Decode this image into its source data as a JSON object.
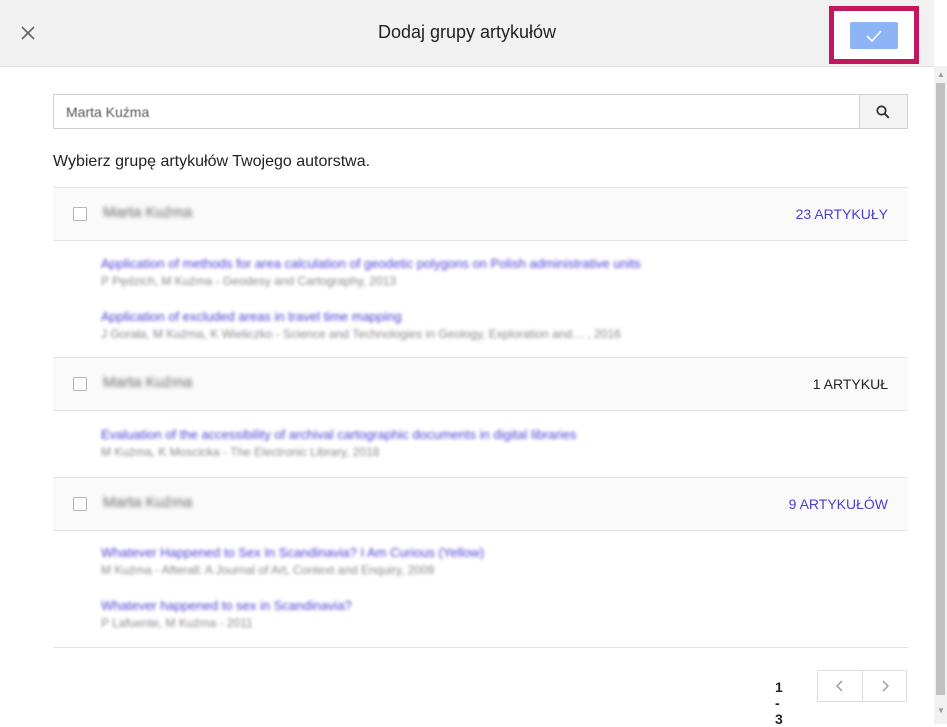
{
  "dialog": {
    "title": "Dodaj grupy artykułów",
    "close_icon": "close-icon",
    "confirm_icon": "check-icon",
    "accent_color": "#8db4f6",
    "highlight_color": "#c2185b"
  },
  "search": {
    "value": "Marta Kuźma",
    "icon": "search-icon"
  },
  "instructions": "Wybierz grupę artykułów Twojego autorstwa.",
  "groups": [
    {
      "name": "Marta Kuźma",
      "count_label": "23 ARTYKUŁY",
      "articles": [
        {
          "title": "Application of methods for area calculation of geodetic polygons on Polish administrative units",
          "meta": "P Pędzich, M Kuźma - Geodesy and Cartography, 2013"
        },
        {
          "title": "Application of excluded areas in travel time mapping",
          "meta": "J Gorała, M Kuźma, K Wieliczko - Science and Technologies in Geology, Exploration and… , 2016"
        }
      ]
    },
    {
      "name": "Marta Kuźma",
      "count_label": "1 ARTYKUŁ",
      "articles": [
        {
          "title": "Evaluation of the accessibility of archival cartographic documents in digital libraries",
          "meta": "M Kuźma, K Moscicka - The Electronic Library, 2018"
        }
      ]
    },
    {
      "name": "Marta Kuźma",
      "count_label": "9 ARTYKUŁÓW",
      "articles": [
        {
          "title": "Whatever Happened to Sex In Scandinavia? I Am Curious (Yellow)",
          "meta": "M Kuźma - Afterall: A Journal of Art, Context and Enquiry, 2009"
        },
        {
          "title": "Whatever happened to sex in Scandinavia?",
          "meta": "P Lafuente, M Kuźma - 2011"
        }
      ]
    }
  ],
  "pagination": {
    "range_label": "1 - 3",
    "prev_icon": "chevron-left-icon",
    "next_icon": "chevron-right-icon"
  }
}
